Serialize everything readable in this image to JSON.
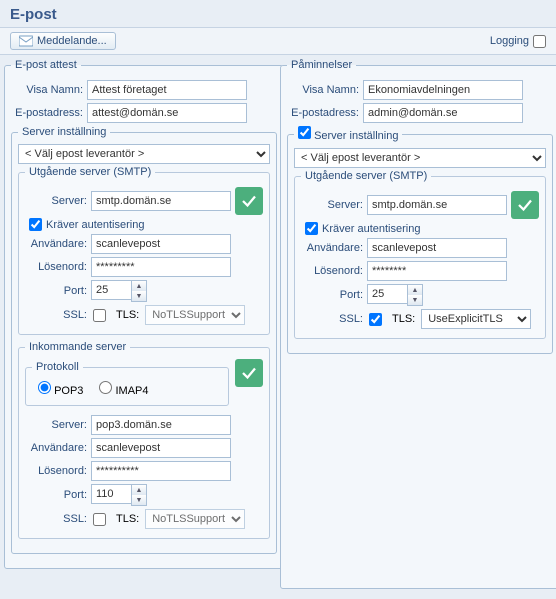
{
  "header": {
    "title": "E-post"
  },
  "toolbar": {
    "meddelande_label": "Meddelande...",
    "logging_label": "Logging"
  },
  "providerPlaceholder": "< Välj epost leverantör >",
  "left": {
    "groupTitle": "E-post attest",
    "visaNamnLabel": "Visa Namn:",
    "visaNamn": "Attest företaget",
    "epostLabel": "E-postadress:",
    "epost": "attest@domän.se",
    "serverInstallLabel": "Server inställning",
    "smtp": {
      "title": "Utgående server (SMTP)",
      "serverLabel": "Server:",
      "server": "smtp.domän.se",
      "authLabel": "Kräver autentisering",
      "userLabel": "Användare:",
      "user": "scanlevepost",
      "passLabel": "Lösenord:",
      "pass": "*********",
      "portLabel": "Port:",
      "port": "25",
      "sslLabel": "SSL:",
      "tlsLabel": "TLS:",
      "tlsValue": "NoTLSSupport"
    },
    "incoming": {
      "title": "Inkommande server",
      "protokollLabel": "Protokoll",
      "pop3": "POP3",
      "imap4": "IMAP4",
      "serverLabel": "Server:",
      "server": "pop3.domän.se",
      "userLabel": "Användare:",
      "user": "scanlevepost",
      "passLabel": "Lösenord:",
      "pass": "**********",
      "portLabel": "Port:",
      "port": "110",
      "sslLabel": "SSL:",
      "tlsLabel": "TLS:",
      "tlsValue": "NoTLSSupport"
    }
  },
  "right": {
    "groupTitle": "Påminnelser",
    "visaNamnLabel": "Visa Namn:",
    "visaNamn": "Ekonomiavdelningen",
    "epostLabel": "E-postadress:",
    "epost": "admin@domän.se",
    "serverInstallLabel": "Server inställning",
    "smtp": {
      "title": "Utgående server (SMTP)",
      "serverLabel": "Server:",
      "server": "smtp.domän.se",
      "authLabel": "Kräver autentisering",
      "userLabel": "Användare:",
      "user": "scanlevepost",
      "passLabel": "Lösenord:",
      "pass": "********",
      "portLabel": "Port:",
      "port": "25",
      "sslLabel": "SSL:",
      "tlsLabel": "TLS:",
      "tlsValue": "UseExplicitTLS"
    }
  }
}
